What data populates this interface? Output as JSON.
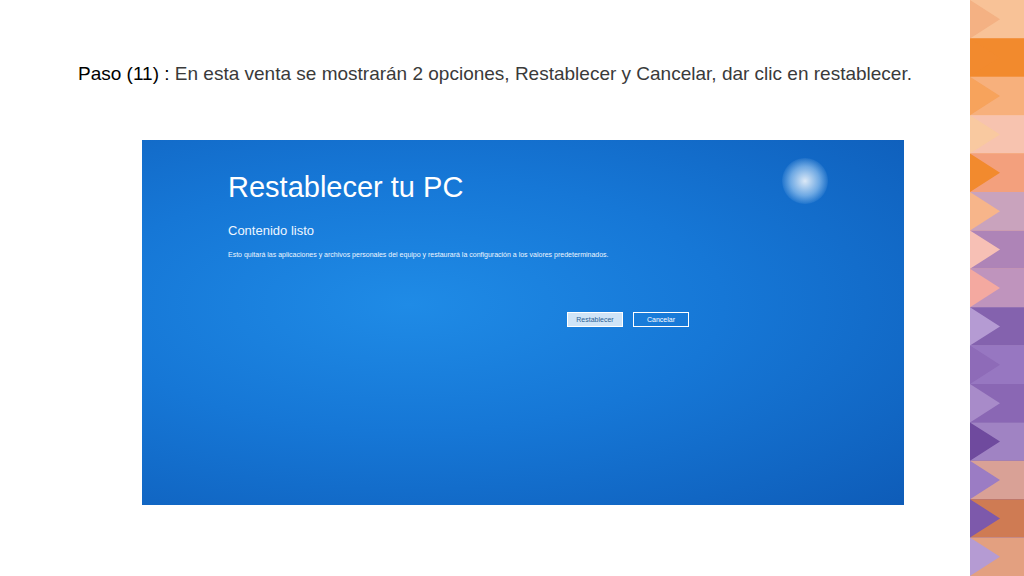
{
  "caption": {
    "step": "Paso (11) :",
    "text": "En esta venta se mostrarán 2 opciones, Restablecer y Cancelar, dar clic en restablecer."
  },
  "screen": {
    "title": "Restablecer tu PC",
    "subtitle": "Contenido listo",
    "description": "Esto quitará las aplicaciones y archivos personales del equipo y restaurará la configuración a los valores predeterminados.",
    "buttons": [
      {
        "label": "Restablecer",
        "selected": true
      },
      {
        "label": "Cancelar",
        "selected": false
      }
    ]
  }
}
